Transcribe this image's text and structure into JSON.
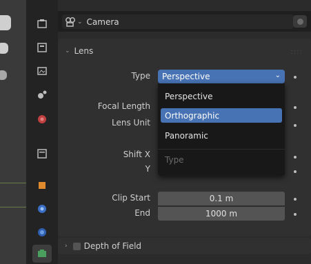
{
  "header": {
    "object_name": "Camera"
  },
  "lens": {
    "title": "Lens",
    "type_label": "Type",
    "type_value": "Perspective",
    "focal_length_label": "Focal Length",
    "lens_unit_label": "Lens Unit",
    "shift_x_label": "Shift X",
    "shift_y_label": "Y",
    "clip_start_label": "Clip Start",
    "clip_start_value": "0.1 m",
    "clip_end_label": "End",
    "clip_end_value": "1000 m"
  },
  "type_dropdown": {
    "options": [
      "Perspective",
      "Orthographic",
      "Panoramic"
    ],
    "selected": "Orthographic",
    "title": "Type"
  },
  "dof": {
    "title": "Depth of Field"
  },
  "colors": {
    "accent": "#4772b3",
    "background": "#2b2b2b",
    "field": "#545454"
  },
  "icons": [
    "tool-icon",
    "render-icon",
    "output-icon",
    "view-layer-icon",
    "scene-icon",
    "world-icon",
    "object-icon",
    "physics-icon",
    "constraints-icon",
    "data-icon",
    "camera-icon",
    "pin-icon"
  ]
}
